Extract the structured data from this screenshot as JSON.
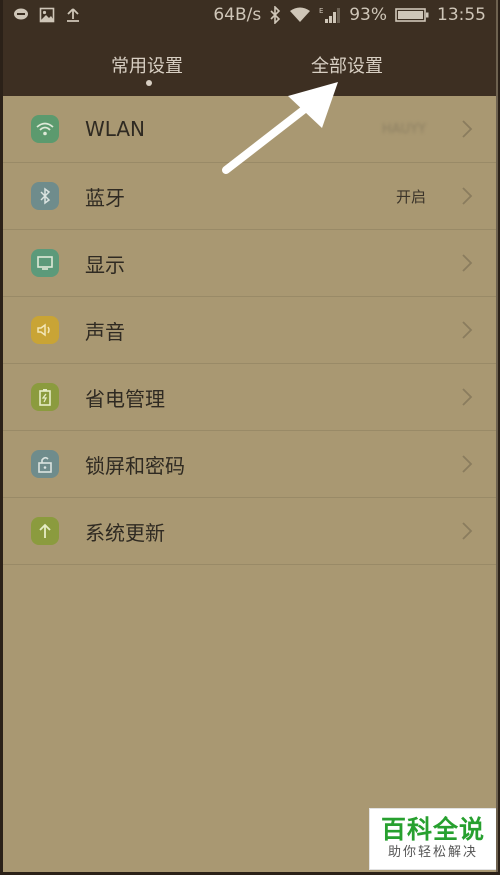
{
  "status_bar": {
    "speed": "64B/s",
    "battery": "93%",
    "time": "13:55",
    "icons": [
      "message-icon",
      "image-icon",
      "upload-icon",
      "bluetooth-icon",
      "wifi-icon",
      "signal-icon",
      "battery-icon"
    ]
  },
  "tabs": [
    {
      "label": "常用设置",
      "active": true
    },
    {
      "label": "全部设置",
      "active": false
    }
  ],
  "settings": [
    {
      "label": "WLAN",
      "value": "HAUYY",
      "icon": "wifi-icon",
      "color": "#5c9a6e"
    },
    {
      "label": "蓝牙",
      "value": "开启",
      "icon": "bluetooth-icon",
      "color": "#6f8c8c"
    },
    {
      "label": "显示",
      "value": "",
      "icon": "monitor-icon",
      "color": "#5c9a7a"
    },
    {
      "label": "声音",
      "value": "",
      "icon": "speaker-icon",
      "color": "#c9a435"
    },
    {
      "label": "省电管理",
      "value": "",
      "icon": "battery-icon",
      "color": "#8b9b3e"
    },
    {
      "label": "锁屏和密码",
      "value": "",
      "icon": "lock-icon",
      "color": "#6f8c8c"
    },
    {
      "label": "系统更新",
      "value": "",
      "icon": "update-arrow-icon",
      "color": "#8b9b3e"
    }
  ],
  "watermark": {
    "title": "百科全说",
    "subtitle": "助你轻松解决"
  }
}
